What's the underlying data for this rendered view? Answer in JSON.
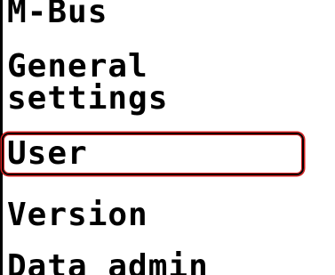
{
  "menu": {
    "items": [
      {
        "label": "M-Bus"
      },
      {
        "label_line1": "General",
        "label_line2": "settings"
      },
      {
        "label": "User",
        "selected": true
      },
      {
        "label": "Version"
      },
      {
        "label": "Data admin"
      }
    ]
  },
  "colors": {
    "text": "#000000",
    "background": "#ffffff",
    "selection_highlight": "#d42020"
  }
}
